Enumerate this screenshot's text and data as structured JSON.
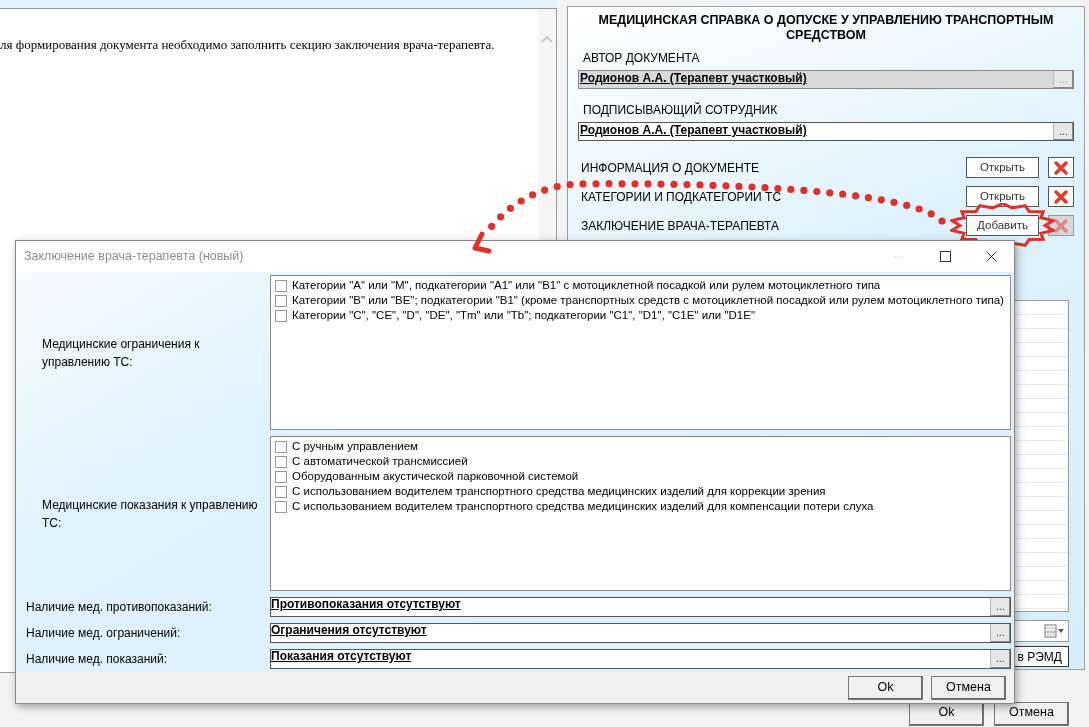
{
  "main_window": {
    "message": "ля формирования документа необходимо заполнить секцию заключения врача-терапевта.",
    "document_panel": {
      "title": "МЕДИЦИНСКАЯ СПРАВКА О ДОПУСКЕ У УПРАВЛЕНИЮ ТРАНСПОРТНЫМ СРЕДСТВОМ",
      "fields": [
        {
          "label": "АВТОР ДОКУМЕНТА",
          "value": "Родионов А.А. (Терапевт участковый)",
          "button": "...",
          "disabled": true
        },
        {
          "label": "ПОДПИСЫВАЮЩИЙ СОТРУДНИК",
          "value": "Родионов А.А. (Терапевт участковый)",
          "button": "...",
          "disabled": false
        }
      ],
      "sections": [
        {
          "label": "ИНФОРМАЦИЯ О ДОКУМЕНТЕ",
          "button": "Открыть",
          "delete_disabled": false,
          "highlighted": false
        },
        {
          "label": "КАТЕГОРИИ И ПОДКАТЕГОРИИ ТС",
          "button": "Открыть",
          "delete_disabled": false,
          "highlighted": false
        },
        {
          "label": "ЗАКЛЮЧЕНИЕ ВРАЧА-ТЕРАПЕВТА",
          "button": "Добавить",
          "delete_disabled": true,
          "highlighted": true
        }
      ],
      "remd_button": "в РЭМД"
    },
    "buttons": [
      "Ok",
      "Отмена"
    ]
  },
  "dialog": {
    "title": "Заключение врача-терапевта (новый)",
    "groups": [
      {
        "label": "Медицинские ограничения к управлению ТС:",
        "options": [
          {
            "label": "Категории \"A\" или \"M\", подкатегории \"A1\" или \"B1\" с мотоциклетной посадкой или рулем мотоциклетного типа",
            "checked": false
          },
          {
            "label": "Категории \"B\" или \"BE\"; подкатегории \"B1\" (кроме транспортных средств с мотоциклетной посадкой или рулем мотоциклетного типа)",
            "checked": false
          },
          {
            "label": "Категории \"C\", \"CE\", \"D\", \"DE\", \"Tm\" или \"Tb\"; подкатегории \"C1\", \"D1\", \"C1E\" или \"D1E\"",
            "checked": false
          }
        ]
      },
      {
        "label": "Медицинские показания к управлению ТС:",
        "options": [
          {
            "label": "С ручным управлением",
            "checked": false
          },
          {
            "label": "С автоматической трансмиссией",
            "checked": false
          },
          {
            "label": "Оборудованным акустической парковочной системой",
            "checked": false
          },
          {
            "label": "С использованием водителем транспортного средства медицинских изделий для коррекции зрения",
            "checked": false
          },
          {
            "label": "С использованием водителем транспортного средства медицинских изделий для компенсации потери слуха",
            "checked": false
          }
        ]
      }
    ],
    "fields": [
      {
        "label": "Наличие мед. противопоказаний:",
        "value": "Противопоказания отсутствуют",
        "button": "..."
      },
      {
        "label": "Наличие мед. ограничений:",
        "value": "Ограничения отсутствуют",
        "button": "..."
      },
      {
        "label": "Наличие мед. показаний:",
        "value": "Показания отсутствуют",
        "button": "..."
      }
    ],
    "buttons": [
      "Ok",
      "Отмена"
    ]
  }
}
